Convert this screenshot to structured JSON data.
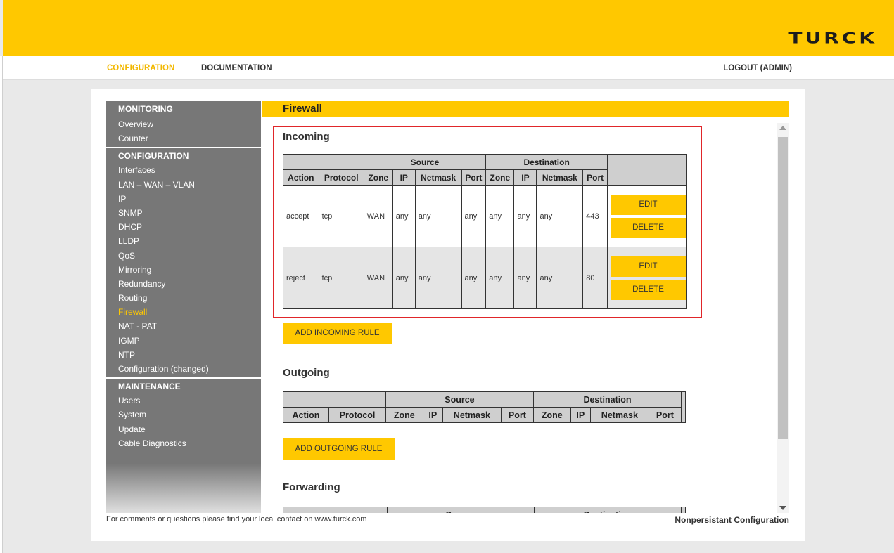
{
  "brand": {
    "logo": "TURCK"
  },
  "nav": {
    "configuration": "CONFIGURATION",
    "documentation": "DOCUMENTATION",
    "logout": "LOGOUT (ADMIN)"
  },
  "sidebar": {
    "monitoring": "MONITORING",
    "monitoring_items": [
      "Overview",
      "Counter"
    ],
    "configuration": "CONFIGURATION",
    "configuration_items": [
      "Interfaces",
      "LAN – WAN – VLAN",
      "IP",
      "SNMP",
      "DHCP",
      "LLDP",
      "QoS",
      "Mirroring",
      "Redundancy",
      "Routing",
      "Firewall",
      "NAT - PAT",
      "IGMP",
      "NTP",
      "Configuration (changed)"
    ],
    "maintenance": "MAINTENANCE",
    "maintenance_items": [
      "Users",
      "System",
      "Update",
      "Cable Diagnostics"
    ]
  },
  "page": {
    "title": "Firewall"
  },
  "incoming": {
    "title": "Incoming",
    "group_source": "Source",
    "group_destination": "Destination",
    "headers": [
      "Action",
      "Protocol",
      "Zone",
      "IP",
      "Netmask",
      "Port",
      "Zone",
      "IP",
      "Netmask",
      "Port"
    ],
    "rows": [
      [
        "accept",
        "tcp",
        "WAN",
        "any",
        "any",
        "any",
        "any",
        "any",
        "any",
        "443"
      ],
      [
        "reject",
        "tcp",
        "WAN",
        "any",
        "any",
        "any",
        "any",
        "any",
        "any",
        "80"
      ]
    ],
    "edit_label": "EDIT",
    "delete_label": "DELETE",
    "add_label": "ADD INCOMING RULE"
  },
  "outgoing": {
    "title": "Outgoing",
    "group_source": "Source",
    "group_destination": "Destination",
    "headers": [
      "Action",
      "Protocol",
      "Zone",
      "IP",
      "Netmask",
      "Port",
      "Zone",
      "IP",
      "Netmask",
      "Port"
    ],
    "add_label": "ADD OUTGOING RULE"
  },
  "forwarding": {
    "title": "Forwarding",
    "group_source": "Source",
    "group_destination": "Destination"
  },
  "footer": {
    "left": "For comments or questions please find your local contact on www.turck.com",
    "right": "Nonpersistant Configuration"
  },
  "colors": {
    "brand_yellow": "#ffc800",
    "sidebar_gray": "#777777",
    "highlight_red": "#e0262a"
  }
}
